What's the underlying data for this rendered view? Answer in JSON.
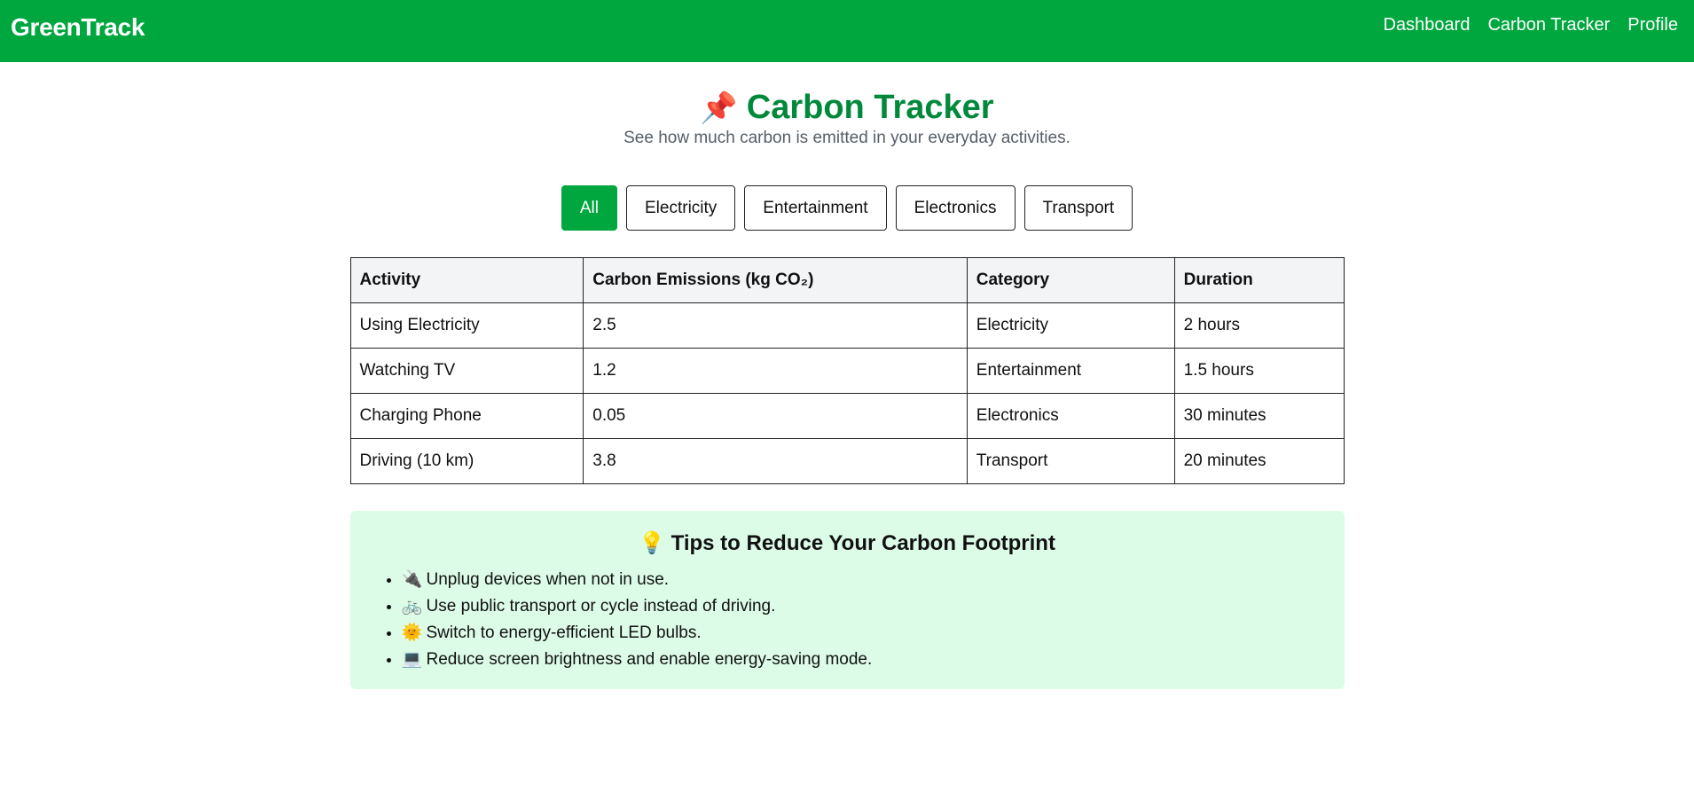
{
  "nav": {
    "brand": "GreenTrack",
    "links": [
      "Dashboard",
      "Carbon Tracker",
      "Profile"
    ]
  },
  "header": {
    "icon": "📌",
    "title": "Carbon Tracker",
    "subtitle": "See how much carbon is emitted in your everyday activities."
  },
  "filters": [
    "All",
    "Electricity",
    "Entertainment",
    "Electronics",
    "Transport"
  ],
  "filter_selected": "All",
  "table": {
    "headers": [
      "Activity",
      "Carbon Emissions (kg CO₂)",
      "Category",
      "Duration"
    ],
    "rows": [
      [
        "Using Electricity",
        "2.5",
        "Electricity",
        "2 hours"
      ],
      [
        "Watching TV",
        "1.2",
        "Entertainment",
        "1.5 hours"
      ],
      [
        "Charging Phone",
        "0.05",
        "Electronics",
        "30 minutes"
      ],
      [
        "Driving (10 km)",
        "3.8",
        "Transport",
        "20 minutes"
      ]
    ]
  },
  "tips": {
    "icon": "💡",
    "title": "Tips to Reduce Your Carbon Footprint",
    "items": [
      {
        "icon": "🔌",
        "text": "Unplug devices when not in use."
      },
      {
        "icon": "🚲",
        "text": "Use public transport or cycle instead of driving."
      },
      {
        "icon": "🌞",
        "text": "Switch to energy-efficient LED bulbs."
      },
      {
        "icon": "💻",
        "text": "Reduce screen brightness and enable energy-saving mode."
      }
    ]
  },
  "colors": {
    "brand_green": "#00a63e",
    "title_green": "#00893a",
    "tips_bg": "#dcfce7"
  }
}
